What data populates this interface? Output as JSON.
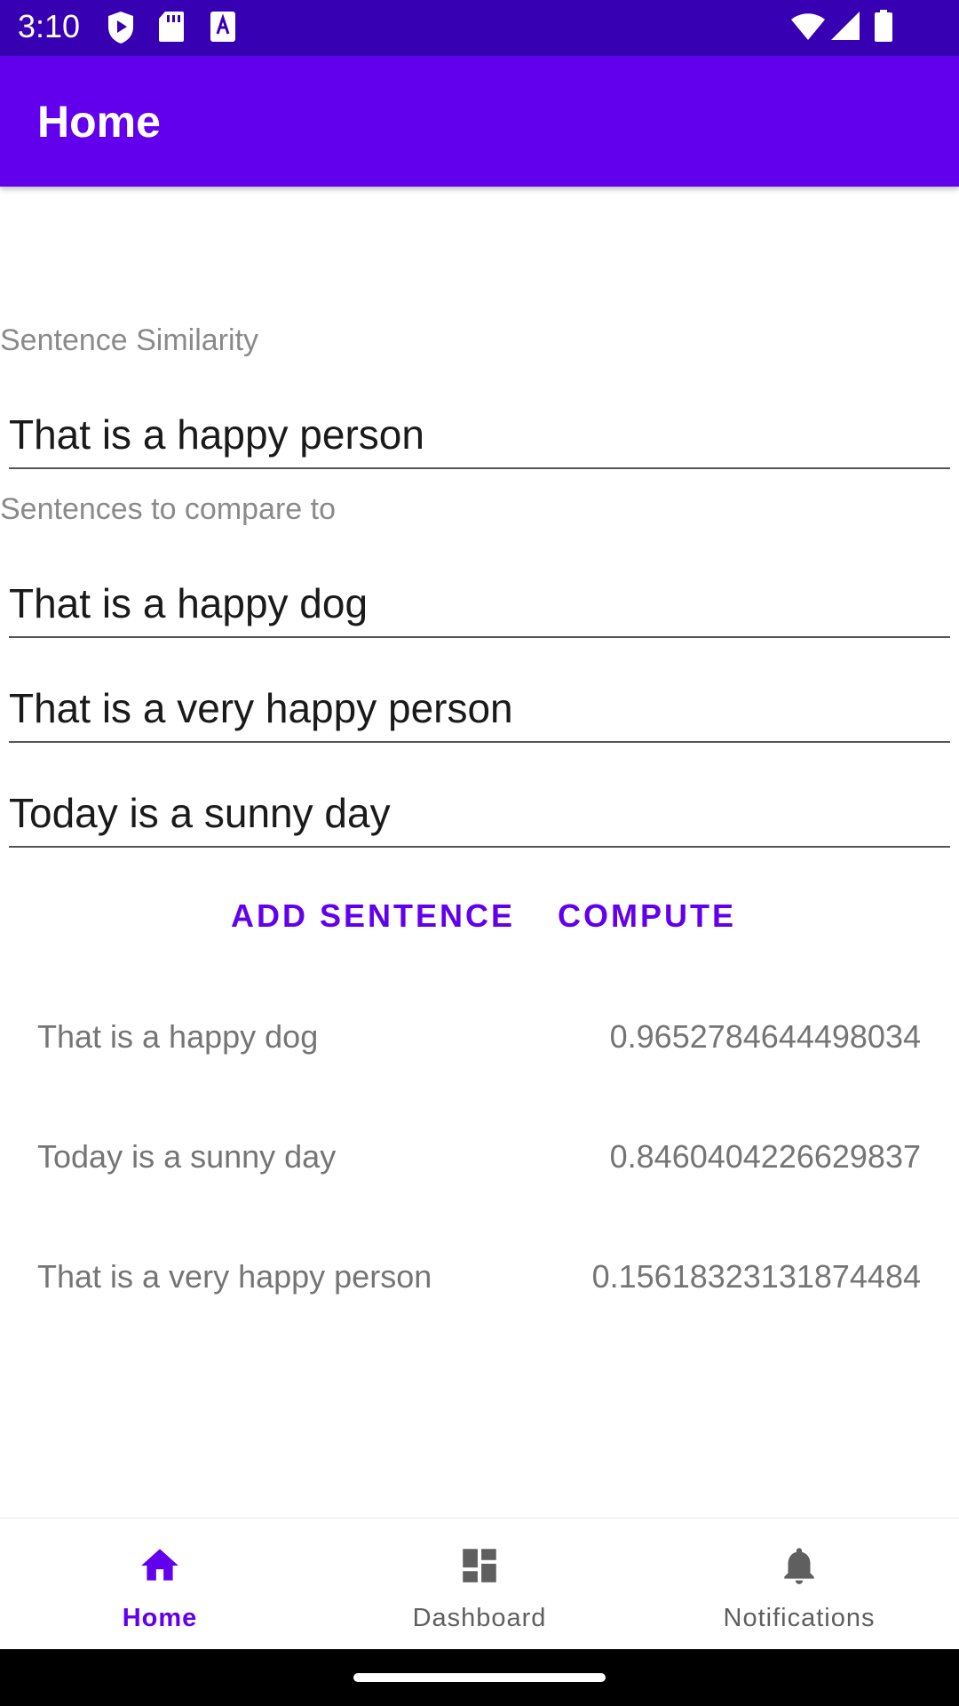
{
  "status_bar": {
    "time": "3:10",
    "left_icons": [
      "play-protect-icon",
      "sd-card-icon",
      "keyboard-a-icon"
    ],
    "right_icons": [
      "wifi-icon",
      "cell-signal-icon",
      "battery-icon"
    ]
  },
  "app_bar": {
    "title": "Home"
  },
  "main": {
    "similarity_label": "Sentence Similarity",
    "source_sentence": "That is a happy person",
    "compare_label": "Sentences to compare to",
    "compare_sentences": [
      "That is a happy dog",
      "That is a very happy person",
      "Today is a sunny day"
    ],
    "add_button_label": "ADD SENTENCE",
    "compute_button_label": "COMPUTE",
    "results": [
      {
        "sentence": "That is a happy dog",
        "score": "0.9652784644498034"
      },
      {
        "sentence": "Today is a sunny day",
        "score": "0.8460404226629837"
      },
      {
        "sentence": "That is a very happy person",
        "score": "0.15618323131874484"
      }
    ]
  },
  "bottom_nav": {
    "items": [
      {
        "label": "Home",
        "icon": "home-icon",
        "active": true
      },
      {
        "label": "Dashboard",
        "icon": "dashboard-icon",
        "active": false
      },
      {
        "label": "Notifications",
        "icon": "bell-icon",
        "active": false
      }
    ]
  },
  "colors": {
    "status_bar": "#3700b3",
    "primary": "#6200ee",
    "secondary_text": "#757575"
  }
}
